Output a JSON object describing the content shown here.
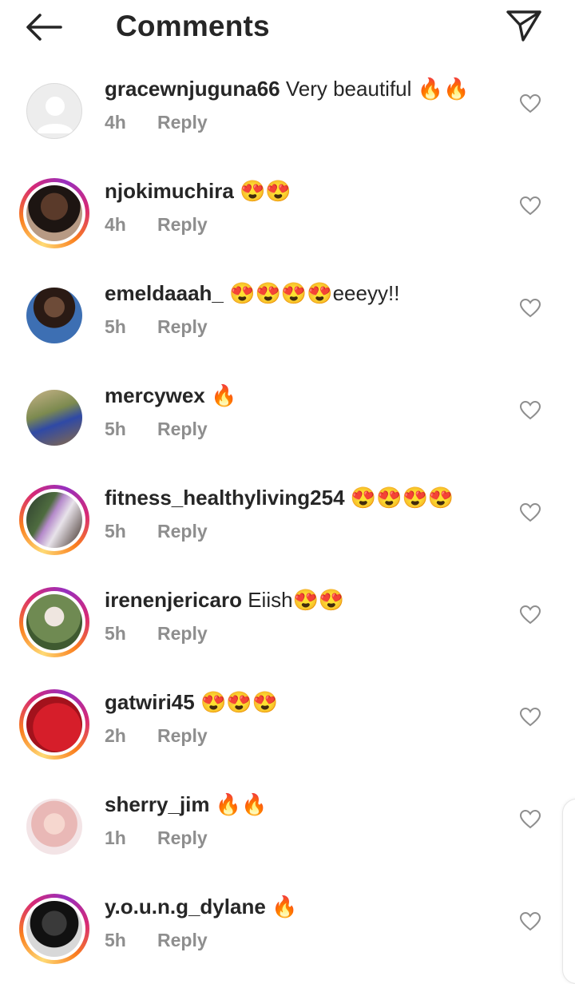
{
  "header": {
    "title": "Comments",
    "back_icon": "arrow-left-icon",
    "share_icon": "paper-plane-icon"
  },
  "colors": {
    "text": "#262626",
    "muted": "#8e8e8e",
    "story_ring": [
      "#feda75",
      "#fa7e1e",
      "#d62976",
      "#962fbf"
    ]
  },
  "comments": [
    {
      "username": "gracewnjuguna66",
      "text": " Very beautiful 🔥🔥",
      "time": "4h",
      "reply": "Reply",
      "ring": false,
      "avatar": "default"
    },
    {
      "username": "njokimuchira",
      "text": " 😍😍",
      "time": "4h",
      "reply": "Reply",
      "ring": true,
      "avatar": "photo"
    },
    {
      "username": "emeldaaah_",
      "text": " 😍😍😍😍eeeyy!!",
      "time": "5h",
      "reply": "Reply",
      "ring": false,
      "avatar": "photo"
    },
    {
      "username": "mercywex",
      "text": " 🔥",
      "time": "5h",
      "reply": "Reply",
      "ring": false,
      "avatar": "photo"
    },
    {
      "username": "fitness_healthyliving254",
      "text": " 😍😍😍😍",
      "time": "5h",
      "reply": "Reply",
      "ring": true,
      "avatar": "photo"
    },
    {
      "username": "irenenjericaro",
      "text": " Eiish😍😍",
      "time": "5h",
      "reply": "Reply",
      "ring": true,
      "avatar": "photo"
    },
    {
      "username": "gatwiri45",
      "text": " 😍😍😍",
      "time": "2h",
      "reply": "Reply",
      "ring": true,
      "avatar": "photo"
    },
    {
      "username": "sherry_jim",
      "text": " 🔥🔥",
      "time": "1h",
      "reply": "Reply",
      "ring": false,
      "avatar": "photo"
    },
    {
      "username": "y.o.u.n.g_dylane",
      "text": " 🔥",
      "time": "5h",
      "reply": "Reply",
      "ring": true,
      "avatar": "photo"
    }
  ]
}
